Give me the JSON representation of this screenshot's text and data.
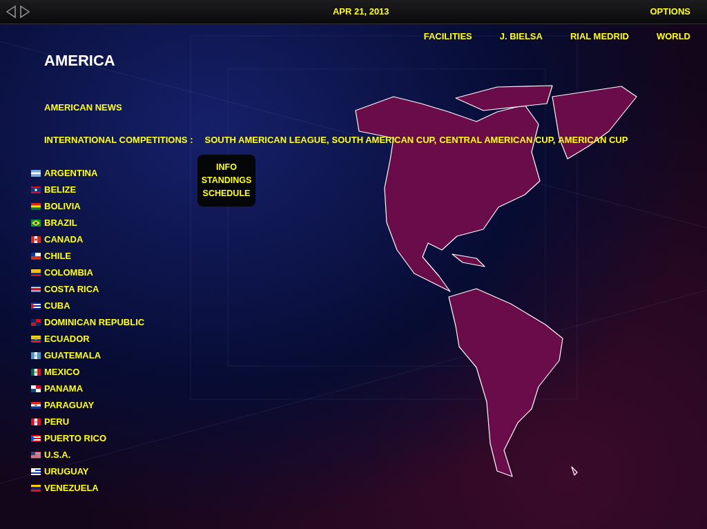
{
  "top_bar": {
    "date": "APR 21, 2013",
    "options": "OPTIONS"
  },
  "nav": [
    "FACILITIES",
    "J. BIELSA",
    "RIAL MEDRID",
    "WORLD"
  ],
  "title": "AMERICA",
  "news_link": "AMERICAN NEWS",
  "competitions": {
    "label": "INTERNATIONAL COMPETITIONS :",
    "items": [
      "SOUTH AMERICAN LEAGUE,",
      "SOUTH AMERICAN CUP,",
      "CENTRAL AMERICAN CUP,",
      "AMERICAN CUP"
    ]
  },
  "popup_menu": [
    "INFO",
    "STANDINGS",
    "SCHEDULE"
  ],
  "countries": [
    "ARGENTINA",
    "BELIZE",
    "BOLIVIA",
    "BRAZIL",
    "CANADA",
    "CHILE",
    "COLOMBIA",
    "COSTA RICA",
    "CUBA",
    "DOMINICAN REPUBLIC",
    "ECUADOR",
    "GUATEMALA",
    "MEXICO",
    "PANAMA",
    "PARAGUAY",
    "PERU",
    "PUERTO RICO",
    "U.S.A.",
    "URUGUAY",
    "VENEZUELA"
  ]
}
